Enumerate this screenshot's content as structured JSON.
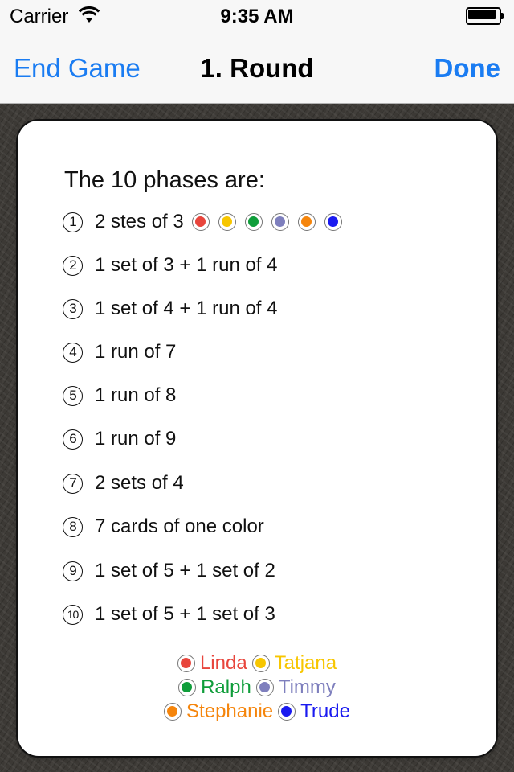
{
  "status_bar": {
    "carrier": "Carrier",
    "time": "9:35 AM"
  },
  "nav": {
    "left_button": "End Game",
    "title": "1. Round",
    "right_button": "Done"
  },
  "content": {
    "heading": "The 10 phases are:",
    "phases": [
      {
        "number": "1",
        "text": "2 stes of 3"
      },
      {
        "number": "2",
        "text": "1 set of 3 + 1 run of 4"
      },
      {
        "number": "3",
        "text": "1 set of 4 + 1 run of 4"
      },
      {
        "number": "4",
        "text": "1 run of 7"
      },
      {
        "number": "5",
        "text": "1 run of 8"
      },
      {
        "number": "6",
        "text": "1 run of 9"
      },
      {
        "number": "7",
        "text": "2 sets of 4"
      },
      {
        "number": "8",
        "text": "7 cards of one color"
      },
      {
        "number": "9",
        "text": "1 set of 5 + 1 set of 2"
      },
      {
        "number": "10",
        "text": "1 set of 5 + 1 set of 3"
      }
    ],
    "phase1_dot_colors": [
      "#e8453c",
      "#f7c600",
      "#0f9d3a",
      "#7e7fbd",
      "#f5850c",
      "#1a1af0"
    ],
    "players": [
      {
        "name": "Linda",
        "color": "#e8453c"
      },
      {
        "name": "Tatjana",
        "color": "#f7c600"
      },
      {
        "name": "Ralph",
        "color": "#0f9d3a"
      },
      {
        "name": "Timmy",
        "color": "#7e7fbd"
      },
      {
        "name": "Stephanie",
        "color": "#f5850c"
      },
      {
        "name": "Trude",
        "color": "#1a1af0"
      }
    ]
  },
  "colors": {
    "accent": "#1a7cf2"
  }
}
